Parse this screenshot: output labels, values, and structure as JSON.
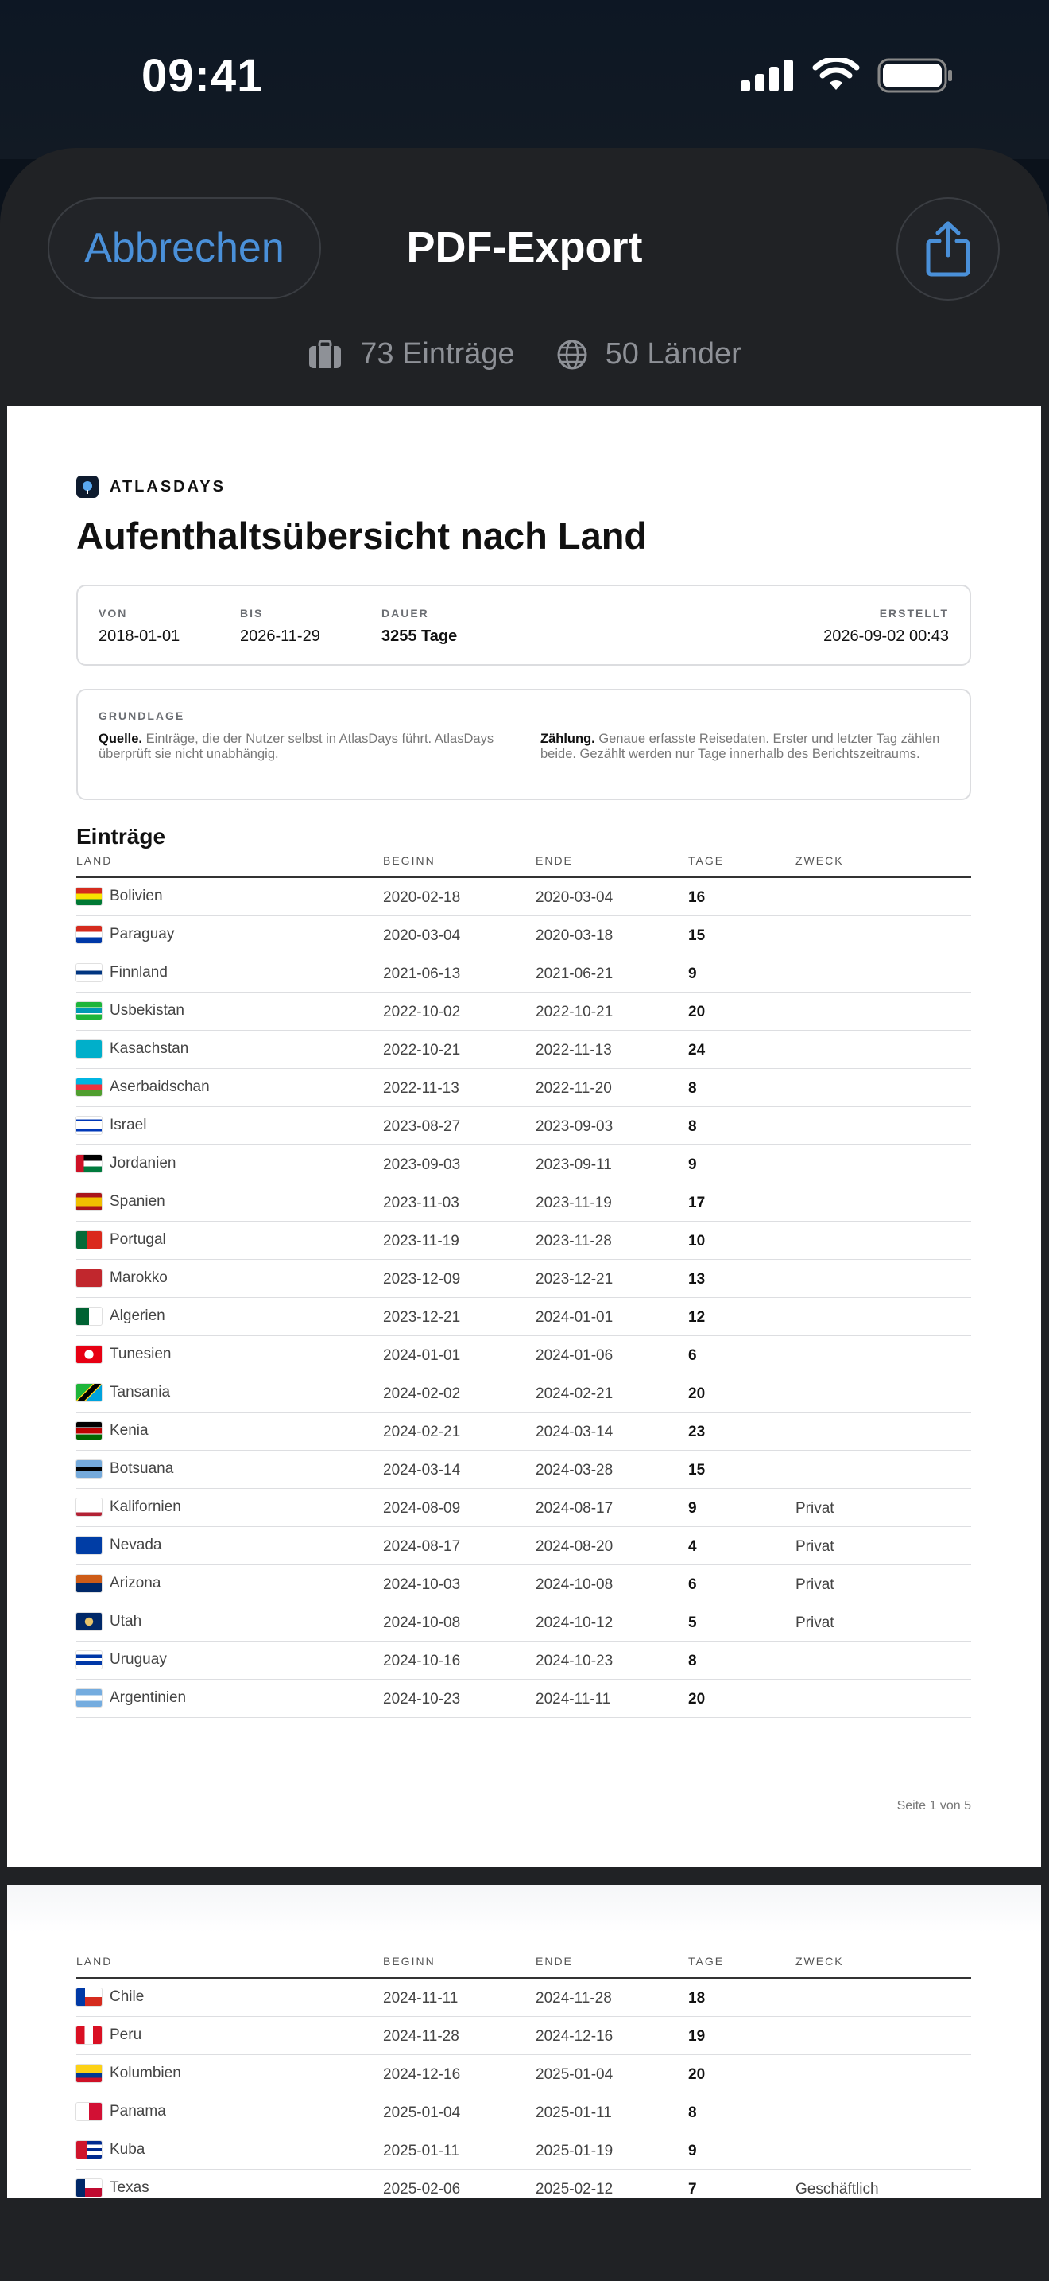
{
  "status_bar": {
    "time": "09:41"
  },
  "header": {
    "cancel_label": "Abbrechen",
    "title": "PDF-Export"
  },
  "stats": {
    "entries": "73 Einträge",
    "countries": "50 Länder"
  },
  "doc": {
    "brand": "ATLASDAYS",
    "title": "Aufenthaltsübersicht nach Land",
    "meta": {
      "von_label": "VON",
      "von": "2018-01-01",
      "bis_label": "BIS",
      "bis": "2026-11-29",
      "dauer_label": "DAUER",
      "dauer": "3255 Tage",
      "erstellt_label": "ERSTELLT",
      "erstellt": "2026-09-02 00:43"
    },
    "basis": {
      "label": "GRUNDLAGE",
      "left_bold": "Quelle.",
      "left_text": " Einträge, die der Nutzer selbst in AtlasDays führt. AtlasDays überprüft sie nicht unabhängig.",
      "right_bold": "Zählung.",
      "right_text": " Genaue erfasste Reisedaten. Erster und letzter Tag zählen beide. Gezählt werden nur Tage innerhalb des Berichtszeitraums."
    },
    "section_title": "Einträge",
    "columns": {
      "land": "LAND",
      "beginn": "BEGINN",
      "ende": "ENDE",
      "tage": "TAGE",
      "zweck": "ZWECK"
    },
    "page_label": "Seite 1 von 5"
  },
  "rows_page1": [
    {
      "land": "Bolivien",
      "beginn": "2020-02-18",
      "ende": "2020-03-04",
      "tage": "16",
      "zweck": "",
      "flag": "bo"
    },
    {
      "land": "Paraguay",
      "beginn": "2020-03-04",
      "ende": "2020-03-18",
      "tage": "15",
      "zweck": "",
      "flag": "py"
    },
    {
      "land": "Finnland",
      "beginn": "2021-06-13",
      "ende": "2021-06-21",
      "tage": "9",
      "zweck": "",
      "flag": "fi"
    },
    {
      "land": "Usbekistan",
      "beginn": "2022-10-02",
      "ende": "2022-10-21",
      "tage": "20",
      "zweck": "",
      "flag": "uz"
    },
    {
      "land": "Kasachstan",
      "beginn": "2022-10-21",
      "ende": "2022-11-13",
      "tage": "24",
      "zweck": "",
      "flag": "kz"
    },
    {
      "land": "Aserbaidschan",
      "beginn": "2022-11-13",
      "ende": "2022-11-20",
      "tage": "8",
      "zweck": "",
      "flag": "az"
    },
    {
      "land": "Israel",
      "beginn": "2023-08-27",
      "ende": "2023-09-03",
      "tage": "8",
      "zweck": "",
      "flag": "il"
    },
    {
      "land": "Jordanien",
      "beginn": "2023-09-03",
      "ende": "2023-09-11",
      "tage": "9",
      "zweck": "",
      "flag": "jo"
    },
    {
      "land": "Spanien",
      "beginn": "2023-11-03",
      "ende": "2023-11-19",
      "tage": "17",
      "zweck": "",
      "flag": "es"
    },
    {
      "land": "Portugal",
      "beginn": "2023-11-19",
      "ende": "2023-11-28",
      "tage": "10",
      "zweck": "",
      "flag": "pt"
    },
    {
      "land": "Marokko",
      "beginn": "2023-12-09",
      "ende": "2023-12-21",
      "tage": "13",
      "zweck": "",
      "flag": "ma"
    },
    {
      "land": "Algerien",
      "beginn": "2023-12-21",
      "ende": "2024-01-01",
      "tage": "12",
      "zweck": "",
      "flag": "dz"
    },
    {
      "land": "Tunesien",
      "beginn": "2024-01-01",
      "ende": "2024-01-06",
      "tage": "6",
      "zweck": "",
      "flag": "tn"
    },
    {
      "land": "Tansania",
      "beginn": "2024-02-02",
      "ende": "2024-02-21",
      "tage": "20",
      "zweck": "",
      "flag": "tz"
    },
    {
      "land": "Kenia",
      "beginn": "2024-02-21",
      "ende": "2024-03-14",
      "tage": "23",
      "zweck": "",
      "flag": "ke"
    },
    {
      "land": "Botsuana",
      "beginn": "2024-03-14",
      "ende": "2024-03-28",
      "tage": "15",
      "zweck": "",
      "flag": "bw"
    },
    {
      "land": "Kalifornien",
      "beginn": "2024-08-09",
      "ende": "2024-08-17",
      "tage": "9",
      "zweck": "Privat",
      "flag": "ca"
    },
    {
      "land": "Nevada",
      "beginn": "2024-08-17",
      "ende": "2024-08-20",
      "tage": "4",
      "zweck": "Privat",
      "flag": "nv"
    },
    {
      "land": "Arizona",
      "beginn": "2024-10-03",
      "ende": "2024-10-08",
      "tage": "6",
      "zweck": "Privat",
      "flag": "az_us"
    },
    {
      "land": "Utah",
      "beginn": "2024-10-08",
      "ende": "2024-10-12",
      "tage": "5",
      "zweck": "Privat",
      "flag": "ut"
    },
    {
      "land": "Uruguay",
      "beginn": "2024-10-16",
      "ende": "2024-10-23",
      "tage": "8",
      "zweck": "",
      "flag": "uy"
    },
    {
      "land": "Argentinien",
      "beginn": "2024-10-23",
      "ende": "2024-11-11",
      "tage": "20",
      "zweck": "",
      "flag": "ar"
    }
  ],
  "rows_page2": [
    {
      "land": "Chile",
      "beginn": "2024-11-11",
      "ende": "2024-11-28",
      "tage": "18",
      "zweck": "",
      "flag": "cl"
    },
    {
      "land": "Peru",
      "beginn": "2024-11-28",
      "ende": "2024-12-16",
      "tage": "19",
      "zweck": "",
      "flag": "pe"
    },
    {
      "land": "Kolumbien",
      "beginn": "2024-12-16",
      "ende": "2025-01-04",
      "tage": "20",
      "zweck": "",
      "flag": "co"
    },
    {
      "land": "Panama",
      "beginn": "2025-01-04",
      "ende": "2025-01-11",
      "tage": "8",
      "zweck": "",
      "flag": "pa"
    },
    {
      "land": "Kuba",
      "beginn": "2025-01-11",
      "ende": "2025-01-19",
      "tage": "9",
      "zweck": "",
      "flag": "cu"
    },
    {
      "land": "Texas",
      "beginn": "2025-02-06",
      "ende": "2025-02-12",
      "tage": "7",
      "zweck": "Geschäftlich",
      "flag": "tx"
    }
  ]
}
